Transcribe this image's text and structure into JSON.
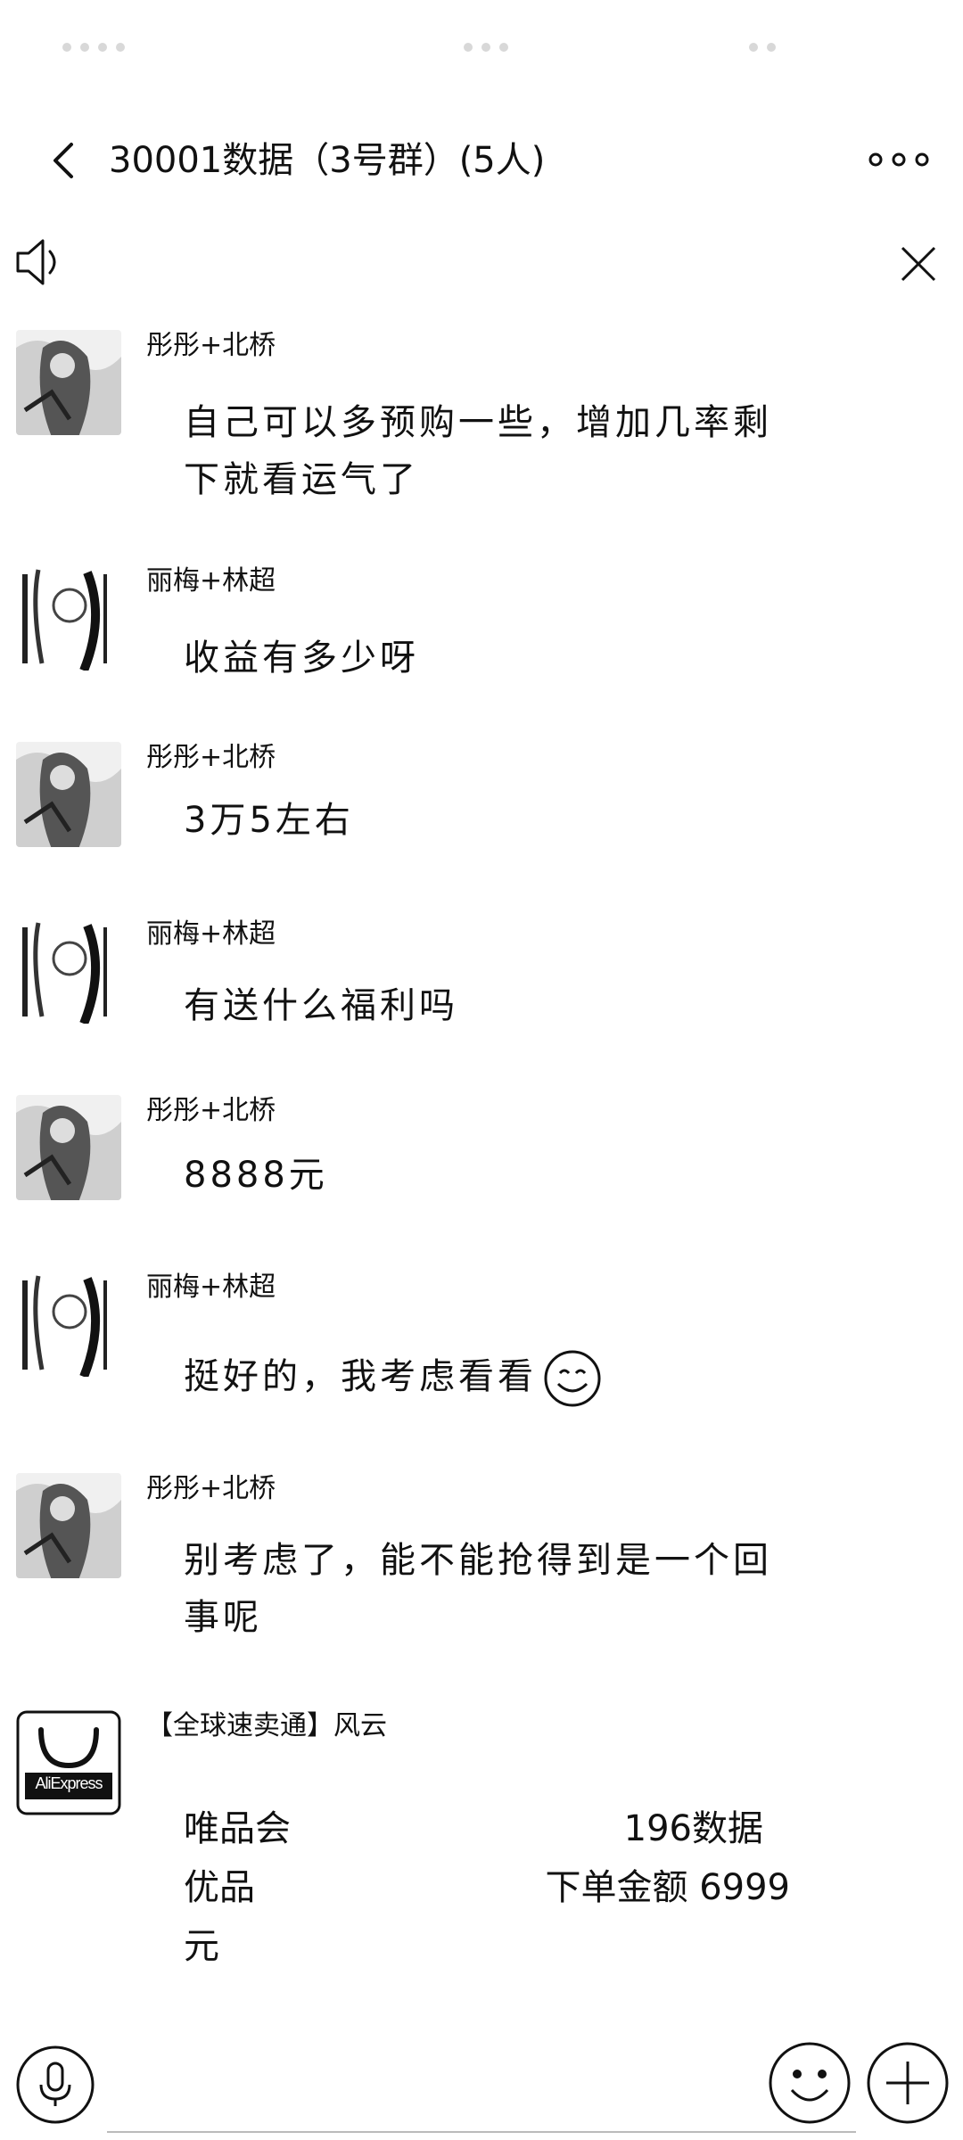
{
  "header": {
    "title": "30001数据（3号群）(5人)",
    "back_icon": "chevron-left-icon",
    "more_icon": "more-dots-icon"
  },
  "notice_bar": {
    "speaker_icon": "speaker-icon",
    "close_icon": "close-icon"
  },
  "messages": [
    {
      "sender": "彤彤+北桥",
      "lines": [
        "自己可以多预购一些，增加几率剩",
        "下就看运气了"
      ]
    },
    {
      "sender": "丽梅+林超",
      "lines": [
        "收益有多少呀"
      ]
    },
    {
      "sender": "彤彤+北桥",
      "lines": [
        "3万5左右"
      ]
    },
    {
      "sender": "丽梅+林超",
      "lines": [
        "有送什么福利吗"
      ]
    },
    {
      "sender": "彤彤+北桥",
      "lines": [
        "8888元"
      ]
    },
    {
      "sender": "丽梅+林超",
      "lines": [
        "挺好的，我考虑看看"
      ],
      "emoji": "smile-emoji-icon"
    },
    {
      "sender": "彤彤+北桥",
      "lines": [
        "别考虑了，能不能抢得到是一个回",
        "事呢"
      ]
    },
    {
      "sender": "【全球速卖通】风云",
      "avatar_label": "AliExpress",
      "card": {
        "row1_left": "唯品会",
        "row1_right": "196数据",
        "row2_left": "优品",
        "row2_right": "下单金额 6999",
        "row3": "元"
      }
    }
  ],
  "bottom": {
    "mic_icon": "microphone-icon",
    "emoji_icon": "smile-icon",
    "plus_icon": "plus-icon"
  }
}
